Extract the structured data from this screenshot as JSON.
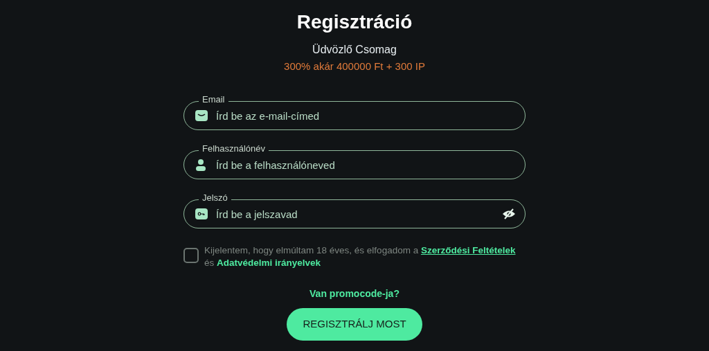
{
  "title": "Regisztráció",
  "welcome": {
    "heading": "Üdvözlő Csomag",
    "offer": "300% akár 400000 Ft + 300 IP"
  },
  "fields": [
    {
      "kind": "email",
      "label": "Email",
      "placeholder": "Írd be az e-mail-címed"
    },
    {
      "kind": "user",
      "label": "Felhasználónév",
      "placeholder": "Írd be a felhasználóneved"
    },
    {
      "kind": "password",
      "label": "Jelszó",
      "placeholder": "Írd be a jelszavad",
      "reveal_toggle": true
    }
  ],
  "consent": {
    "checked": false,
    "text_before": "Kijelentem, hogy elmúltam 18 éves, és elfogadom a",
    "terms_link": "Szerződési Feltételek",
    "text_middle": "és",
    "privacy_link": "Adatvédelmi irányelvek"
  },
  "promo_link": "Van promocode-ja?",
  "submit_button": "REGISZTRÁLJ MOST"
}
